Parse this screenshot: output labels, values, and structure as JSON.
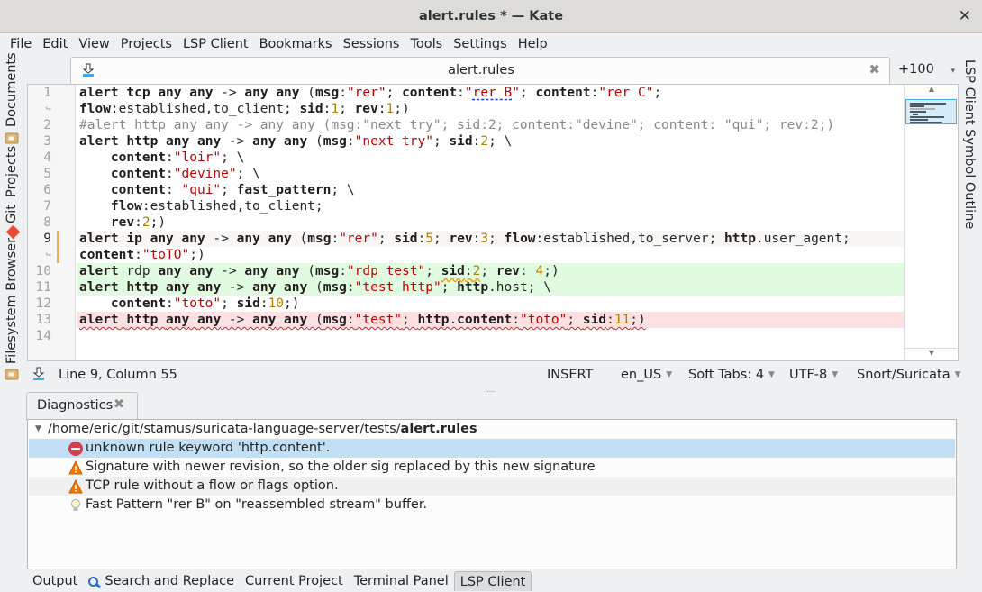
{
  "window": {
    "title": "alert.rules * — Kate",
    "close_icon": "close-icon"
  },
  "menu": [
    "File",
    "Edit",
    "View",
    "Projects",
    "LSP Client",
    "Bookmarks",
    "Sessions",
    "Tools",
    "Settings",
    "Help"
  ],
  "menu_underline": [
    "F",
    "E",
    "V",
    "P",
    "L",
    "B",
    "i",
    "T",
    "S",
    "H"
  ],
  "left_sidebar": {
    "tabs": [
      "Documents",
      "Projects",
      "Git",
      "Filesystem Browser"
    ]
  },
  "right_sidebar": {
    "tabs": [
      "LSP Client Symbol Outline"
    ]
  },
  "tabbar": {
    "active_tab": "alert.rules",
    "quick_open": "+100"
  },
  "editor": {
    "line_numbers": [
      "1",
      "↪",
      "2",
      "3",
      "4",
      "5",
      "6",
      "7",
      "8",
      "9",
      "↪",
      "10",
      "11",
      "12",
      "13",
      "14"
    ],
    "current_line": "9",
    "lines": [
      "alert tcp any any -> any any (msg:\"rer\"; content:\"rer B\"; content:\"rer C\";",
      "flow:established,to_client; sid:1; rev:1;)",
      "#alert http any any -> any any (msg:\"next try\"; sid:2; content:\"devine\"; content: \"qui\"; rev:2;)",
      "alert http any any -> any any (msg:\"next try\"; sid:2; \\",
      "    content:\"loir\"; \\",
      "    content:\"devine\"; \\",
      "    content: \"qui\"; fast_pattern; \\",
      "    flow:established,to_client;",
      "    rev:2;)",
      "alert ip any any -> any any (msg:\"rer\"; sid:5; rev:3; flow:established,to_server; http.user_agent;",
      "content:\"toTO\";)",
      "alert rdp any any -> any any (msg:\"rdp test\"; sid:2; rev: 4;)",
      "alert http any any -> any any (msg:\"test http\"; http.host; \\",
      "    content:\"toto\"; sid:10;)",
      "alert http any any -> any any (msg:\"test\"; http.content:\"toto\"; sid:11;)",
      ""
    ]
  },
  "statusbar": {
    "position": "Line 9, Column 55",
    "mode": "INSERT",
    "dictionary": "en_US",
    "indent": "Soft Tabs: 4",
    "encoding": "UTF-8",
    "syntax": "Snort/Suricata"
  },
  "diagnostics": {
    "tab_label": "Diagnostics",
    "file_path": "/home/eric/git/stamus/suricata-language-server/tests/",
    "file_name": "alert.rules",
    "items": [
      {
        "severity": "error",
        "icon": "error-icon",
        "message": "unknown rule keyword 'http.content'."
      },
      {
        "severity": "warning",
        "icon": "warning-icon",
        "message": "Signature with newer revision, so the older sig replaced by this new signature"
      },
      {
        "severity": "warning",
        "icon": "warning-icon",
        "message": "TCP rule without a flow or flags option."
      },
      {
        "severity": "hint",
        "icon": "lightbulb-icon",
        "message": "Fast Pattern \"rer B\" on \"reassembled stream\" buffer."
      }
    ]
  },
  "bottom_tabs": [
    "Output",
    "Search and Replace",
    "Current Project",
    "Terminal Panel",
    "LSP Client"
  ],
  "bottom_active": "LSP Client",
  "colors": {
    "keyword": "#1f1c1b",
    "string": "#bf0303",
    "number": "#b08000",
    "comment": "#898887",
    "error_bg": "#fde1e2",
    "added_bg": "#e1fbe0",
    "selection": "#c2e0f5"
  }
}
